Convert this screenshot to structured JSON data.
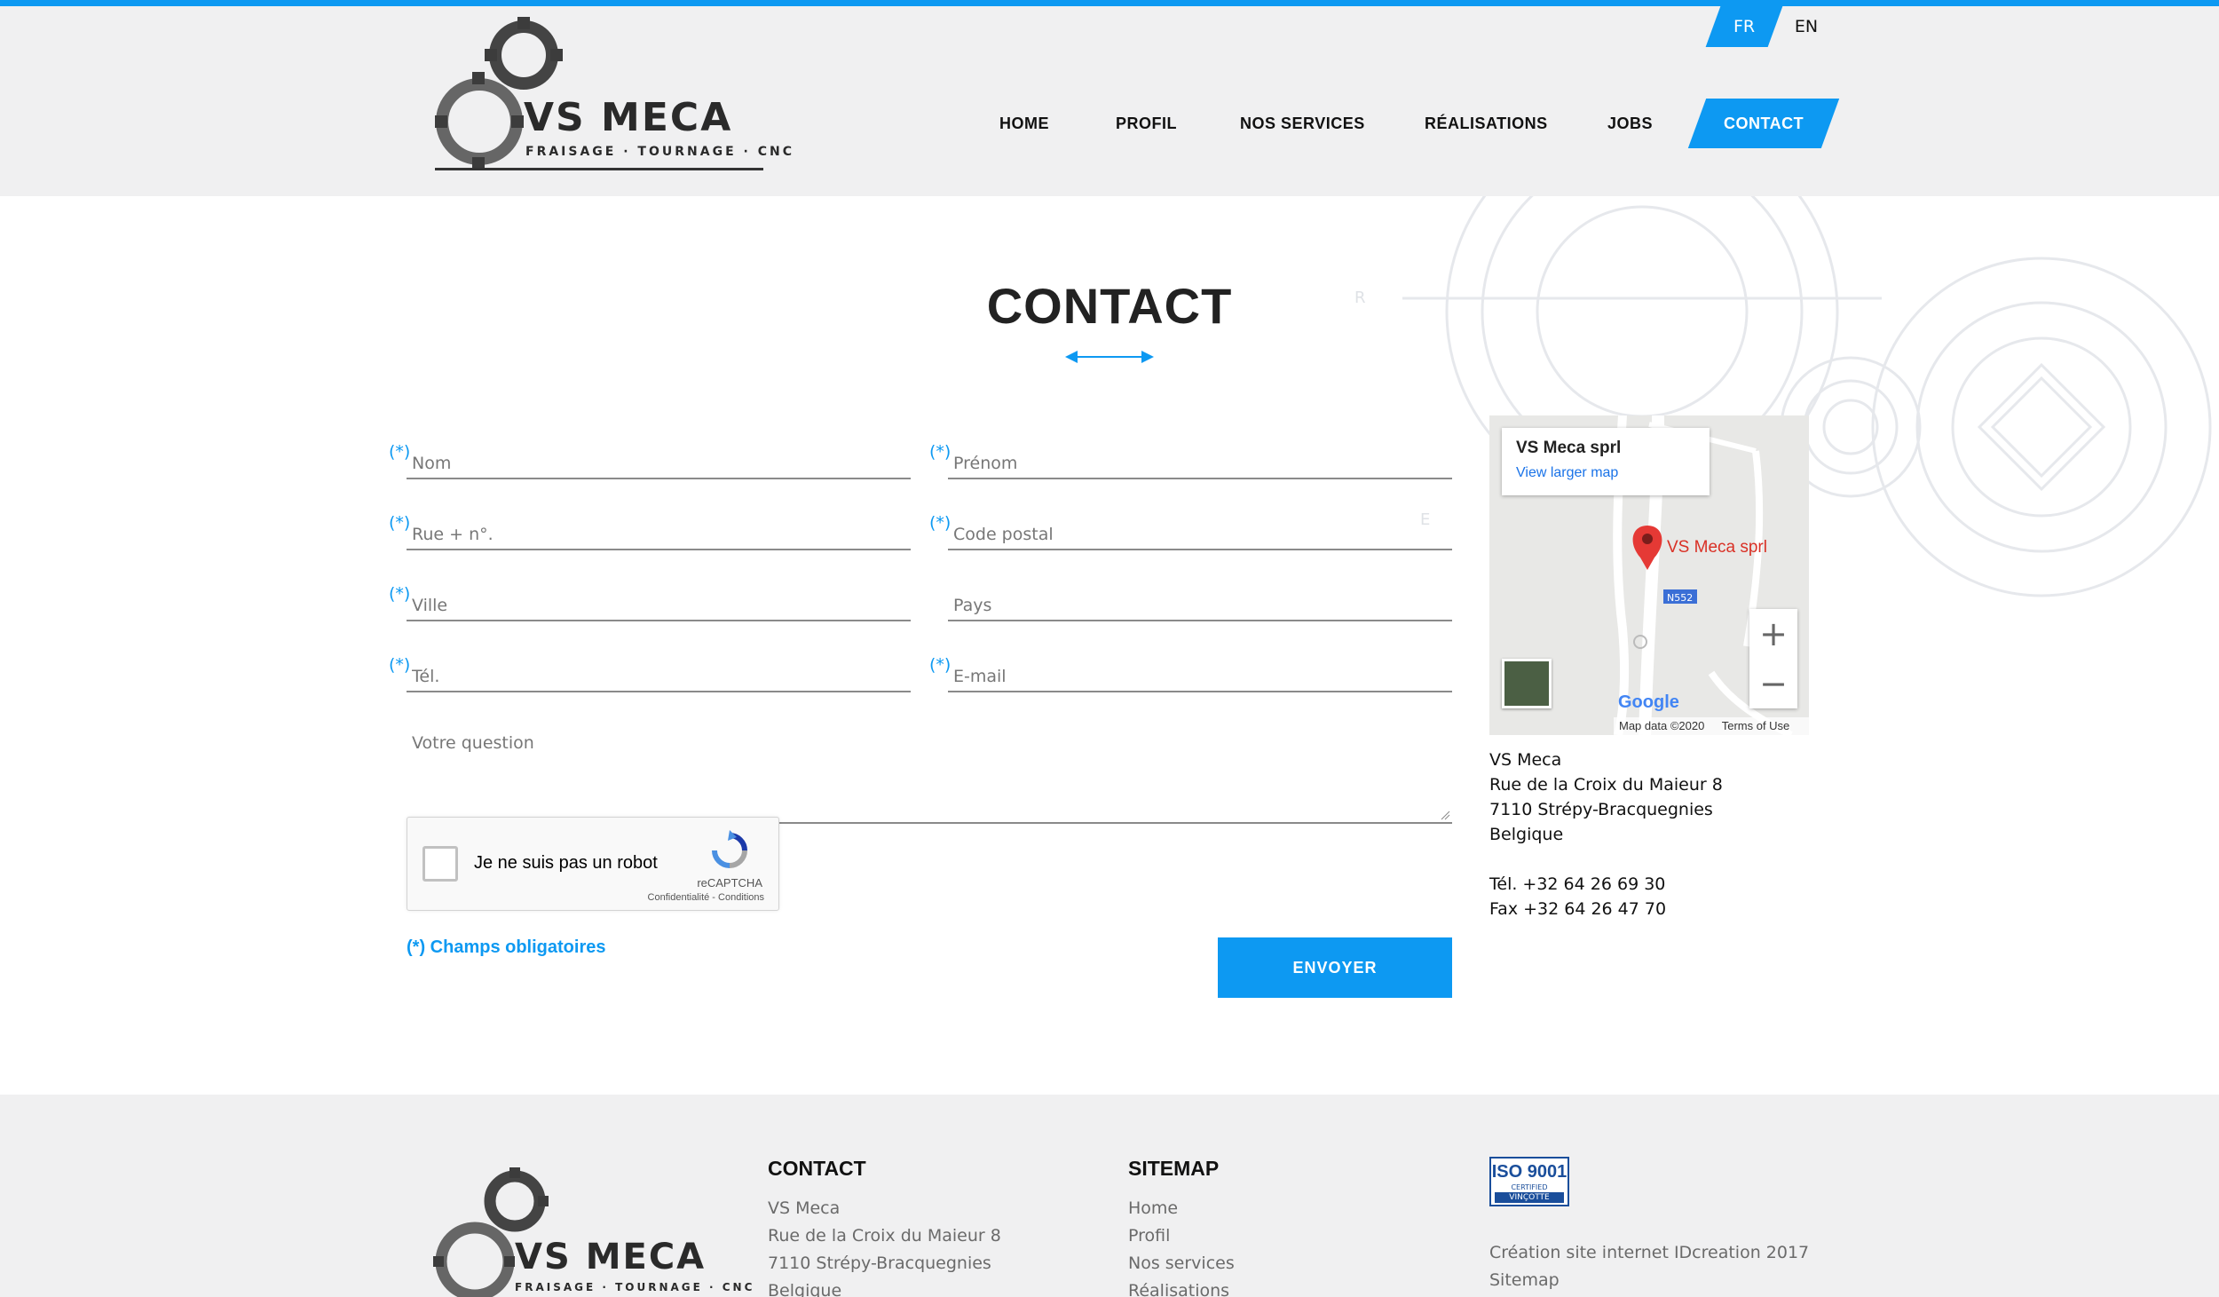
{
  "brand": {
    "name": "VS MECA",
    "tagline": "FRAISAGE · TOURNAGE · CNC",
    "accent_color": "#0d99f2"
  },
  "lang": {
    "fr": "FR",
    "en": "EN",
    "active": "FR"
  },
  "nav": {
    "items": [
      {
        "label": "HOME"
      },
      {
        "label": "PROFIL"
      },
      {
        "label": "NOS SERVICES"
      },
      {
        "label": "RÉALISATIONS"
      },
      {
        "label": "JOBS"
      },
      {
        "label": "CONTACT"
      }
    ],
    "active": "CONTACT"
  },
  "page": {
    "title": "CONTACT"
  },
  "form": {
    "required_marker": "(*)",
    "fields": {
      "nom": {
        "placeholder": "Nom",
        "required": true
      },
      "prenom": {
        "placeholder": "Prénom",
        "required": true
      },
      "rue": {
        "placeholder": "Rue + n°.",
        "required": true
      },
      "code_postal": {
        "placeholder": "Code postal",
        "required": true
      },
      "ville": {
        "placeholder": "Ville",
        "required": true
      },
      "pays": {
        "placeholder": "Pays",
        "required": false
      },
      "tel": {
        "placeholder": "Tél.",
        "required": true
      },
      "email": {
        "placeholder": "E-mail",
        "required": true
      },
      "question": {
        "placeholder": "Votre question",
        "required": false
      }
    },
    "captcha": {
      "label": "Je ne suis pas un robot",
      "brand": "reCAPTCHA",
      "links": "Confidentialité - Conditions",
      "checked": false
    },
    "required_note": "(*) Champs obligatoires",
    "submit_label": "ENVOYER"
  },
  "map": {
    "card_title": "VS Meca sprl",
    "card_link": "View larger map",
    "pin_label": "VS Meca sprl",
    "road_label": "N552",
    "google": "Google",
    "attribution": "Map data ©2020",
    "terms": "Terms of Use",
    "zoom_in": "+",
    "zoom_out": "−"
  },
  "address": {
    "company": "VS Meca",
    "street": "Rue de la Croix du Maieur 8",
    "city": "7110 Strépy-Bracquegnies",
    "country": "Belgique",
    "phone": "Tél. +32 64 26 69 30",
    "fax": "Fax +32 64 26 47 70"
  },
  "footer": {
    "contact": {
      "heading": "CONTACT",
      "lines": [
        "VS Meca",
        "Rue de la Croix du Maieur 8",
        "7110 Strépy-Bracquegnies",
        "Belgique"
      ]
    },
    "sitemap": {
      "heading": "SITEMAP",
      "links": [
        "Home",
        "Profil",
        "Nos services",
        "Réalisations"
      ]
    },
    "iso": {
      "top": "ISO 9001",
      "mid": "CERTIFIED",
      "bottom": "VINÇOTTE"
    },
    "credit": "Création site internet IDcreation 2017",
    "sitemap_link": "Sitemap"
  }
}
